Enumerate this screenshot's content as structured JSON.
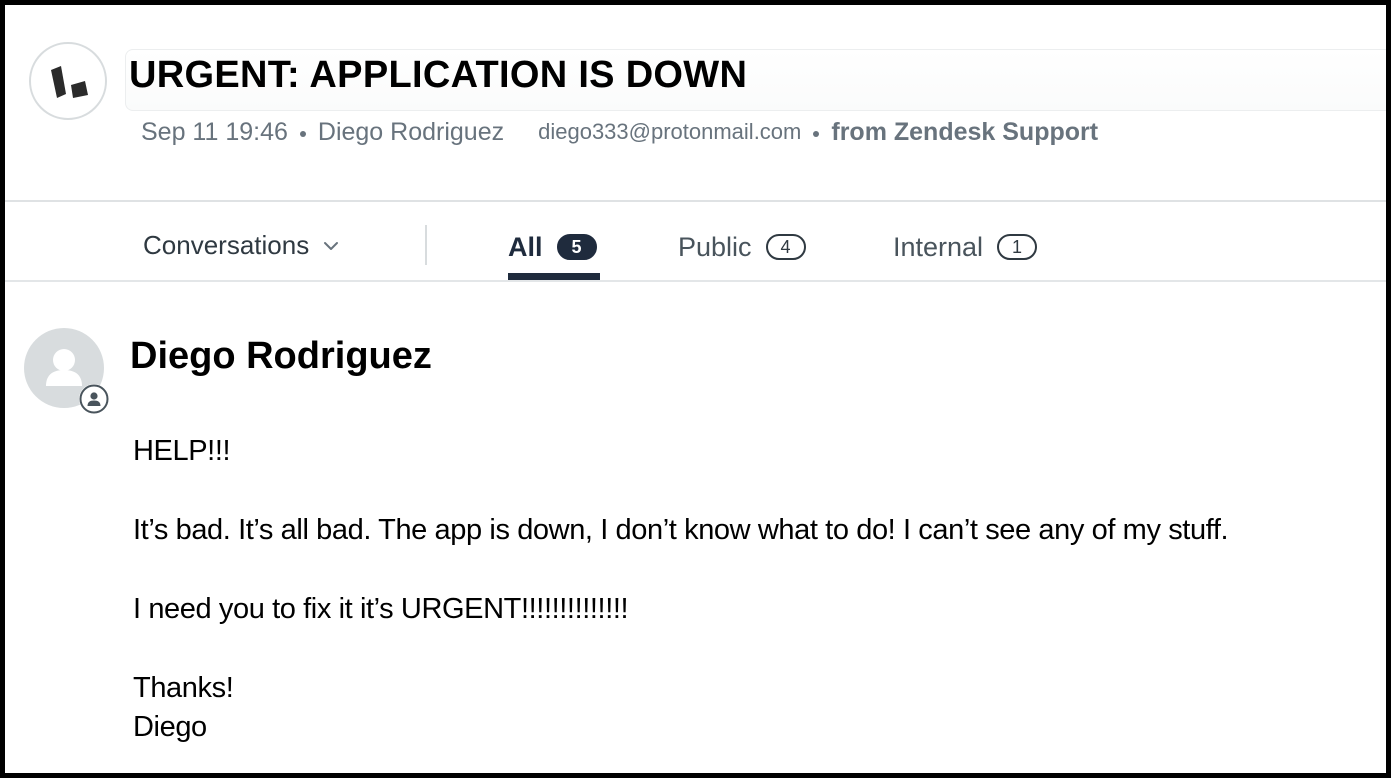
{
  "ticket": {
    "subject": "URGENT: APPLICATION IS DOWN",
    "timestamp": "Sep 11 19:46",
    "requester_name": "Diego Rodriguez",
    "requester_email": "diego333@protonmail.com",
    "source": "from Zendesk Support"
  },
  "tabs_bar": {
    "conversations_label": "Conversations",
    "tabs": [
      {
        "label": "All",
        "count": "5",
        "active": true
      },
      {
        "label": "Public",
        "count": "4",
        "active": false
      },
      {
        "label": "Internal",
        "count": "1",
        "active": false
      }
    ]
  },
  "message": {
    "author": "Diego Rodriguez",
    "lines": [
      "HELP!!!",
      "It’s bad. It’s all bad. The app is down, I don’t know what to do! I can’t see any of my stuff.",
      "I need you to fix it it’s URGENT!!!!!!!!!!!!!!",
      "Thanks!",
      "Diego"
    ]
  },
  "icons": {
    "brand": "zendesk-logo-icon",
    "chevron": "chevron-down-icon",
    "avatar": "user-avatar-icon",
    "badge": "requester-badge-icon"
  },
  "colors": {
    "text_muted": "#68737d",
    "tab_active": "#1f2b3d",
    "divider": "#dfe2e4",
    "avatar_bg": "#d8dcde"
  }
}
